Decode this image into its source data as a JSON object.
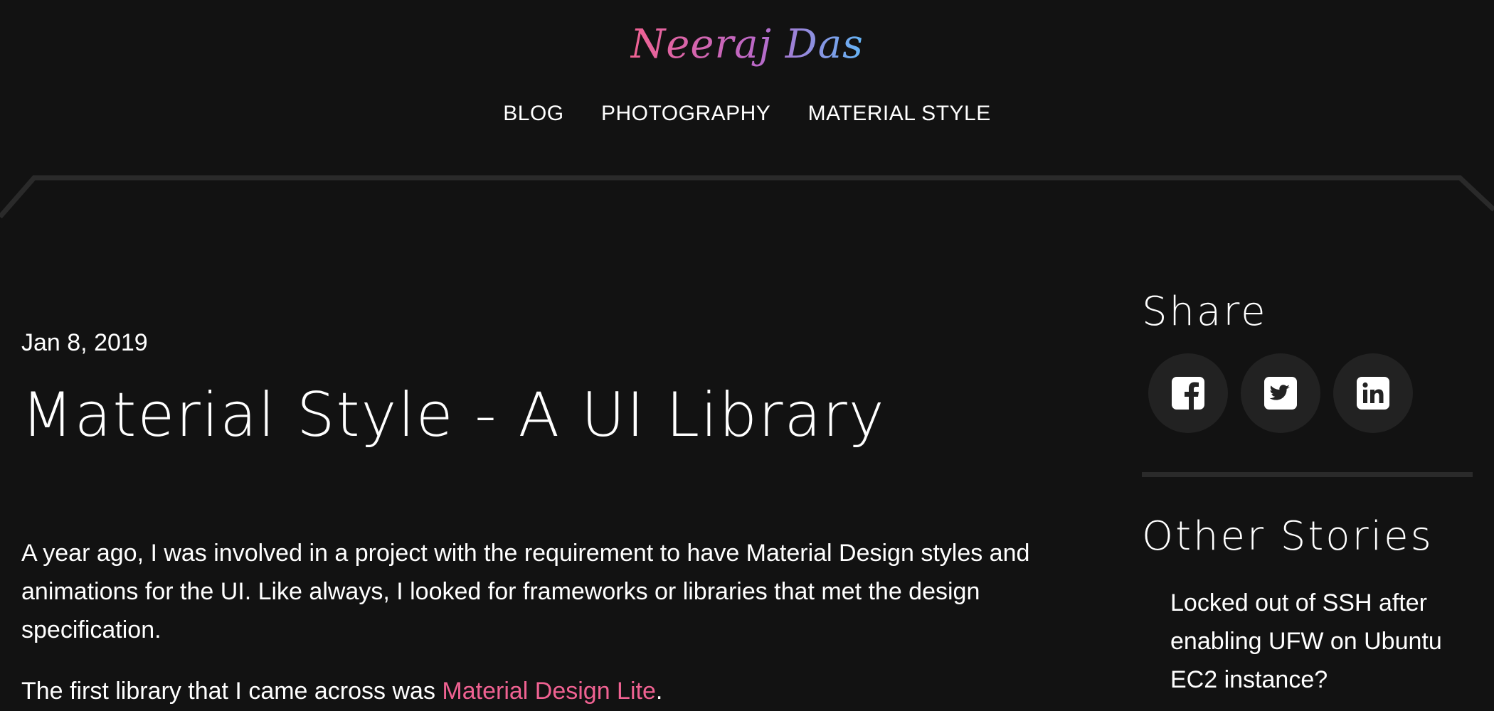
{
  "site": {
    "logo_text": "Neeraj Das",
    "logo_gradient": [
      "#f06292",
      "#ba68c8",
      "#64b5f6"
    ]
  },
  "nav": {
    "items": [
      {
        "label": "BLOG"
      },
      {
        "label": "PHOTOGRAPHY"
      },
      {
        "label": "MATERIAL STYLE"
      }
    ]
  },
  "post": {
    "date": "Jan 8, 2019",
    "title": "Material Style - A UI Library",
    "paragraph_1": "A year ago, I was involved in a project with the requirement to have Material Design styles and animations for the UI. Like always, I looked for frameworks or libraries that met the design specification.",
    "paragraph_2_prefix": "The first library that I came across was ",
    "paragraph_2_link": "Material Design Lite",
    "paragraph_2_suffix": "."
  },
  "sidebar": {
    "share_heading": "Share",
    "share_icons": [
      "facebook-icon",
      "twitter-icon",
      "linkedin-icon"
    ],
    "other_heading": "Other Stories",
    "stories": [
      {
        "title": "Locked out of SSH after enabling UFW on Ubuntu EC2 instance?"
      }
    ]
  },
  "colors": {
    "background": "#121212",
    "accent_link": "#f06292",
    "share_button_bg": "#222222",
    "divider": "#2a2a2a"
  }
}
